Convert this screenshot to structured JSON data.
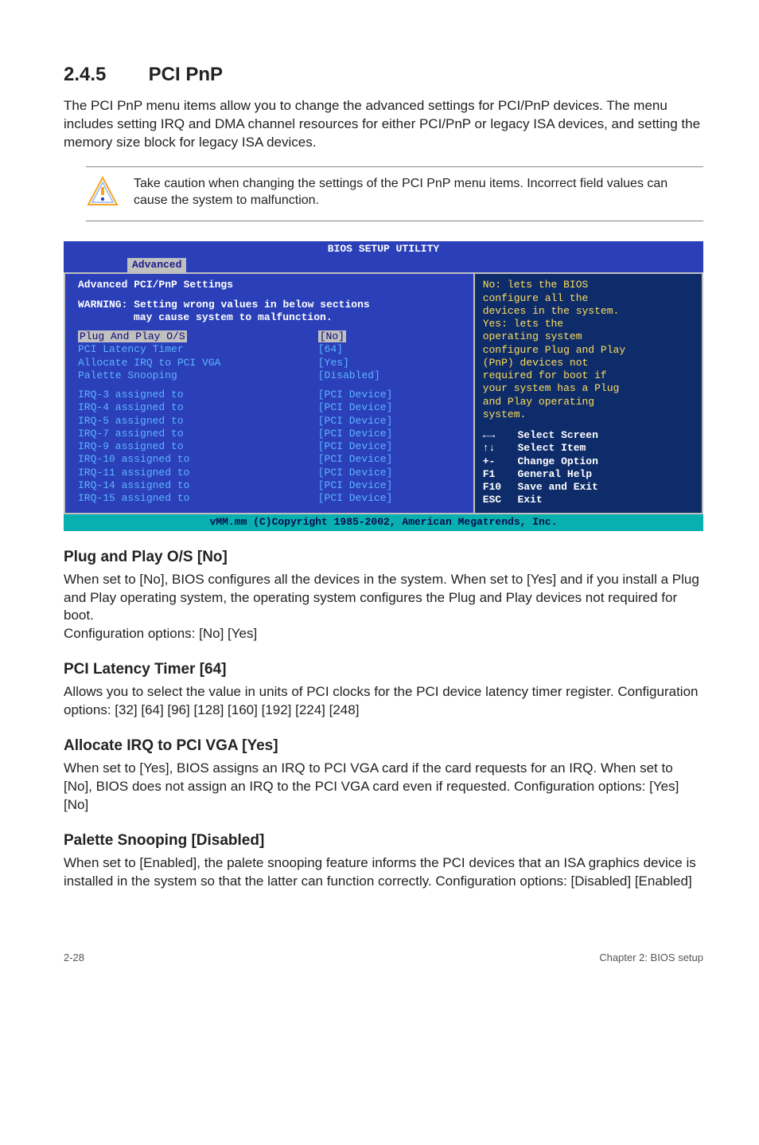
{
  "heading": {
    "num": "2.4.5",
    "title": "PCI PnP"
  },
  "intro": "The PCI PnP menu items allow you to change the advanced settings for PCI/PnP devices. The menu includes setting IRQ and DMA channel resources for either PCI/PnP or legacy ISA devices, and setting the memory size block for legacy ISA devices.",
  "callout": "Take caution when changing the settings of the PCI PnP menu items. Incorrect field values can cause the system to malfunction.",
  "bios": {
    "title": "BIOS SETUP UTILITY",
    "tab": "Advanced",
    "heading1": "Advanced PCI/PnP Settings",
    "warning_label": "WARNING:",
    "warning_line1": "Setting wrong values in below sections",
    "warning_line2": "may cause system to malfunction.",
    "rows_top": [
      {
        "label": "Plug And Play O/S",
        "value": "[No]",
        "highlight": true
      },
      {
        "label": "PCI Latency Timer",
        "value": "[64]"
      },
      {
        "label": "Allocate IRQ to PCI VGA",
        "value": "[Yes]"
      },
      {
        "label": "Palette Snooping",
        "value": "[Disabled]"
      }
    ],
    "rows_irq": [
      {
        "label": "IRQ-3 assigned to",
        "value": "[PCI Device]"
      },
      {
        "label": "IRQ-4 assigned to",
        "value": "[PCI Device]"
      },
      {
        "label": "IRQ-5 assigned to",
        "value": "[PCI Device]"
      },
      {
        "label": "IRQ-7 assigned to",
        "value": "[PCI Device]"
      },
      {
        "label": "IRQ-9 assigned to",
        "value": "[PCI Device]"
      },
      {
        "label": "IRQ-10 assigned to",
        "value": "[PCI Device]"
      },
      {
        "label": "IRQ-11 assigned to",
        "value": "[PCI Device]"
      },
      {
        "label": "IRQ-14 assigned to",
        "value": "[PCI Device]"
      },
      {
        "label": "IRQ-15 assigned to",
        "value": "[PCI Device]"
      }
    ],
    "help": {
      "l1": "No: lets the BIOS",
      "l2": "configure all the",
      "l3": "devices in the system.",
      "l4": "Yes: lets the",
      "l5": "operating system",
      "l6": "configure Plug and Play",
      "l7": "(PnP) devices not",
      "l8": "required for boot if",
      "l9": "your system has a Plug",
      "l10": "and Play operating",
      "l11": "system."
    },
    "keys": [
      {
        "k": "←→",
        "d": "Select Screen"
      },
      {
        "k": "↑↓",
        "d": "Select Item"
      },
      {
        "k": "+-",
        "d": "Change Option"
      },
      {
        "k": "F1",
        "d": "General Help"
      },
      {
        "k": "F10",
        "d": "Save and Exit"
      },
      {
        "k": "ESC",
        "d": "Exit"
      }
    ],
    "footer": "vMM.mm (C)Copyright 1985-2002, American Megatrends, Inc."
  },
  "subs": [
    {
      "title": "Plug and Play O/S [No]",
      "text": "When set to [No], BIOS configures all the devices in the system. When set to [Yes] and if you install a Plug and Play operating system, the operating system configures the Plug and Play devices not required for boot.\nConfiguration options: [No] [Yes]"
    },
    {
      "title": "PCI Latency Timer [64]",
      "text": "Allows you to select the value in units of PCI clocks for the PCI device latency timer register. Configuration options: [32] [64] [96] [128] [160] [192] [224] [248]"
    },
    {
      "title": "Allocate IRQ to PCI VGA [Yes]",
      "text": "When set to [Yes], BIOS assigns an IRQ to PCI VGA card if the card requests for an IRQ. When set to [No], BIOS does not assign an IRQ to the PCI VGA card even if requested. Configuration options: [Yes] [No]"
    },
    {
      "title": "Palette Snooping [Disabled]",
      "text": "When set to [Enabled], the palete snooping feature informs the PCI devices that an ISA graphics device is installed in the system so that the latter can function correctly. Configuration options: [Disabled] [Enabled]"
    }
  ],
  "footer": {
    "left": "2-28",
    "right": "Chapter 2: BIOS setup"
  }
}
